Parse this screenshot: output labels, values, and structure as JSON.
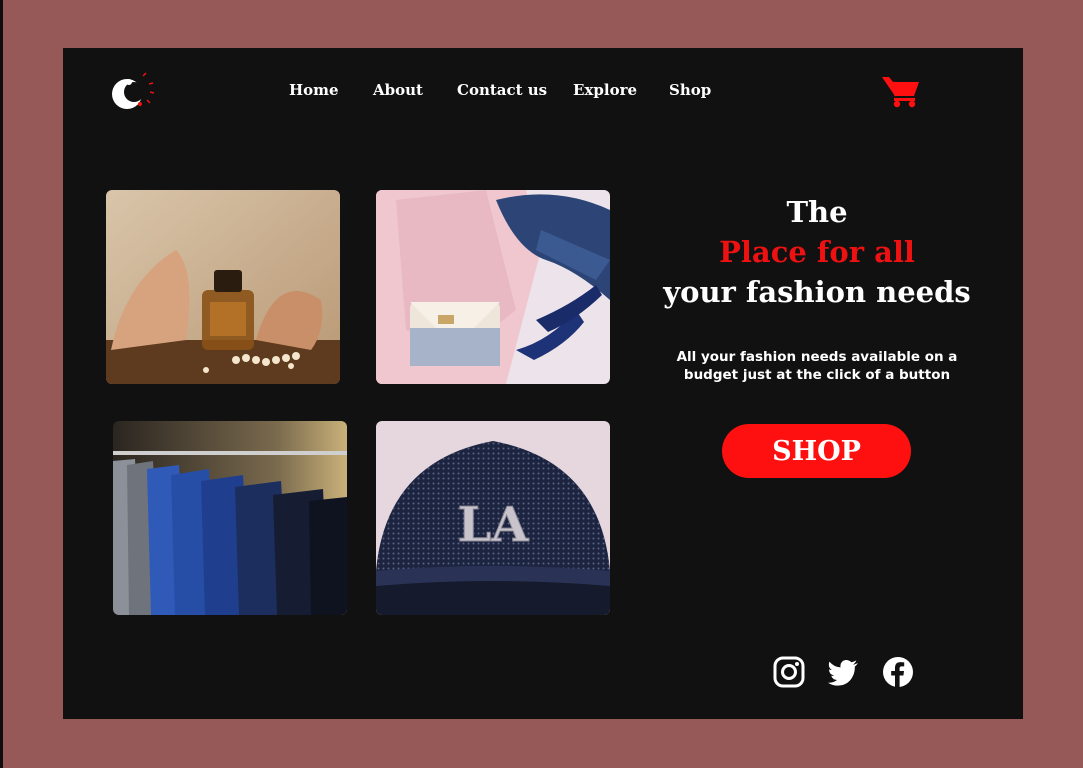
{
  "colors": {
    "page_background": "#965957",
    "frame_background": "#111111",
    "accent_red": "#ff1010",
    "text_white": "#ffffff"
  },
  "header": {
    "logo_icon": "crescent-c-logo-icon",
    "nav": [
      {
        "label": "Home"
      },
      {
        "label": "About"
      },
      {
        "label": "Contact us"
      },
      {
        "label": "Explore"
      },
      {
        "label": "Shop"
      }
    ],
    "cart_icon": "shopping-cart-icon"
  },
  "gallery": [
    {
      "subject": "sandals-perfume-pearls-photo"
    },
    {
      "subject": "pink-coat-handbag-heels-photo"
    },
    {
      "subject": "suits-on-rack-photo"
    },
    {
      "subject": "la-cap-photo"
    }
  ],
  "hero": {
    "line1": "The",
    "line2": "Place for all",
    "line3": "your fashion needs",
    "subtitle_line1": "All your fashion needs available on a",
    "subtitle_line2": "budget just at the click of a button",
    "cta_label": "SHOP"
  },
  "social": [
    {
      "icon": "instagram-icon"
    },
    {
      "icon": "twitter-icon"
    },
    {
      "icon": "facebook-icon"
    }
  ]
}
